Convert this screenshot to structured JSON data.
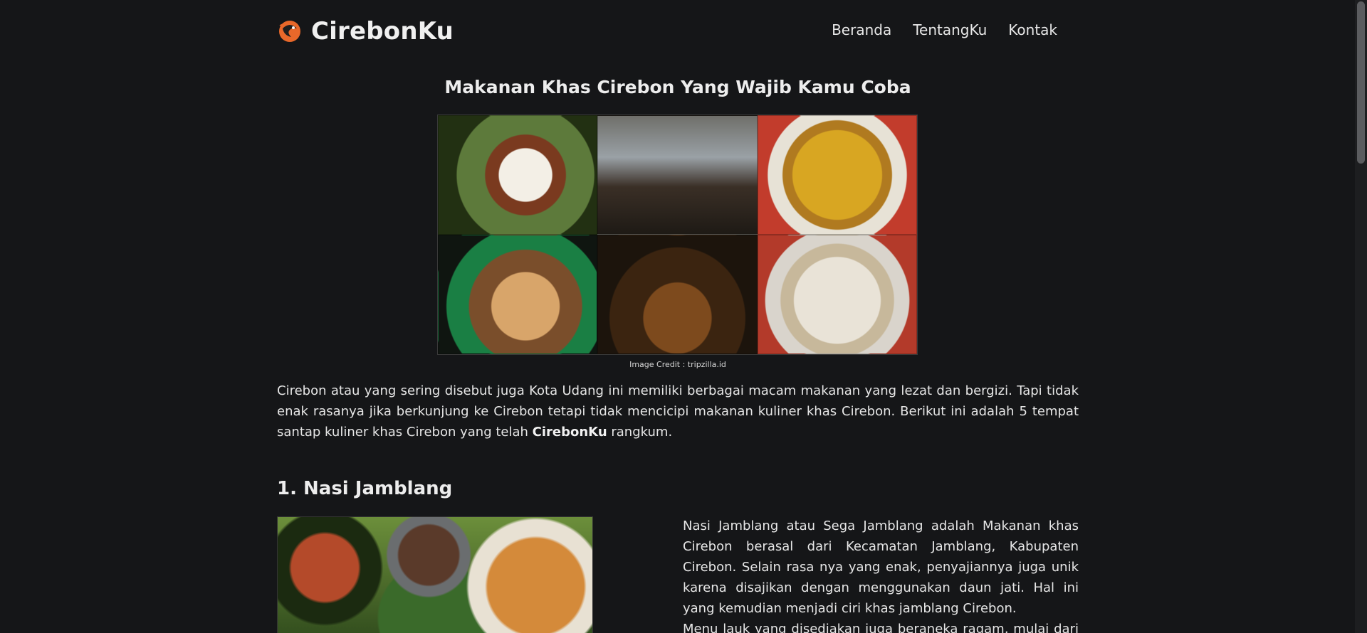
{
  "header": {
    "brand": "CirebonKu",
    "nav": [
      "Beranda",
      "TentangKu",
      "Kontak"
    ]
  },
  "article": {
    "title": "Makanan Khas Cirebon Yang Wajib Kamu Coba",
    "image_credit": "Image Credit : tripzilla.id",
    "intro": {
      "text_before": "Cirebon atau yang sering disebut juga Kota Udang ini memiliki berbagai macam makanan yang lezat dan bergizi. Tapi tidak enak rasanya jika berkunjung ke Cirebon tetapi tidak mencicipi makanan kuliner khas Cirebon. Berikut ini adalah 5 tempat santap kuliner khas Cirebon yang telah ",
      "brand_bold": "CirebonKu",
      "text_after": " rangkum."
    },
    "sections": [
      {
        "title": "1. Nasi Jamblang",
        "paragraphs": [
          "Nasi Jamblang atau Sega Jamblang adalah Makanan khas Cirebon berasal dari Kecamatan Jamblang, Kabupaten Cirebon. Selain rasa nya yang enak, penyajiannya juga unik karena disajikan dengan menggunakan daun jati. Hal ini yang kemudian menjadi ciri khas jamblang Cirebon.",
          "Menu lauk yang disediakan juga beraneka ragam, mulai dari tahu"
        ]
      }
    ]
  },
  "colors": {
    "background": "#151618",
    "text": "#e6e6e6",
    "logo_accent": "#e8682a"
  }
}
